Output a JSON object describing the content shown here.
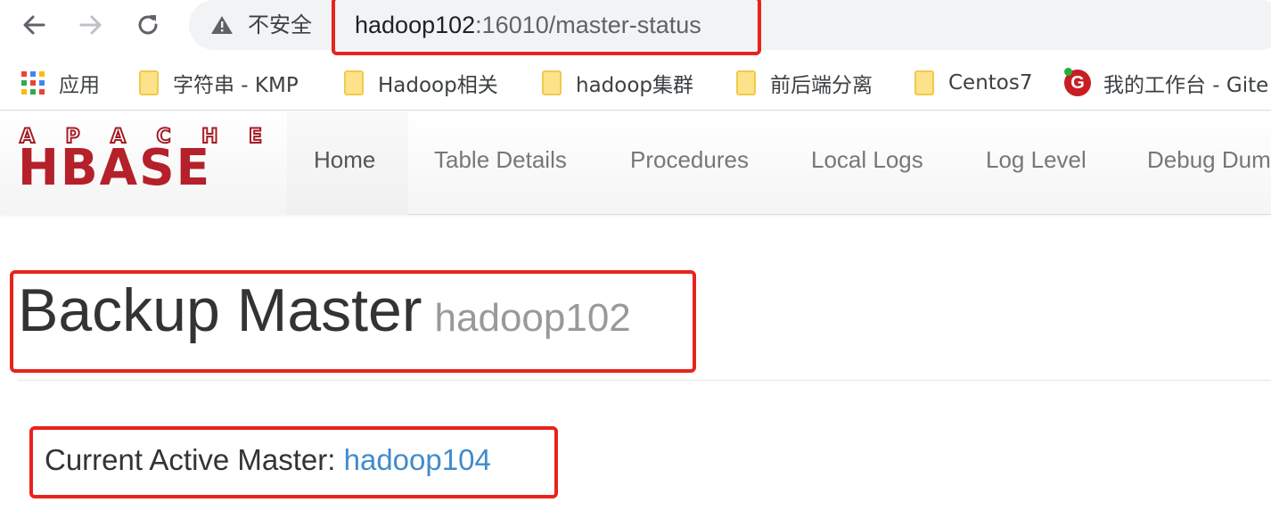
{
  "browser": {
    "security_label": "不安全",
    "url_host": "hadoop102",
    "url_path": ":16010/master-status",
    "icons": {
      "back": "back-arrow-icon",
      "forward": "forward-arrow-icon",
      "reload": "reload-icon",
      "warning": "warning-triangle-icon"
    }
  },
  "bookmarks": [
    {
      "label": "应用",
      "icon": "apps-grid-icon"
    },
    {
      "label": "字符串 - KMP",
      "icon": "folder-icon"
    },
    {
      "label": "Hadoop相关",
      "icon": "folder-icon"
    },
    {
      "label": "hadoop集群",
      "icon": "folder-icon"
    },
    {
      "label": "前后端分离",
      "icon": "folder-icon"
    },
    {
      "label": "Centos7",
      "icon": "folder-icon"
    },
    {
      "label": "我的工作台 - Gite",
      "icon": "gitee-icon"
    }
  ],
  "hbase": {
    "logo_top": "APACHE",
    "logo_main": "HBASE",
    "nav": [
      {
        "label": "Home",
        "active": true
      },
      {
        "label": "Table Details"
      },
      {
        "label": "Procedures"
      },
      {
        "label": "Local Logs"
      },
      {
        "label": "Log Level"
      },
      {
        "label": "Debug Dum"
      }
    ]
  },
  "page": {
    "title": "Backup Master",
    "title_host": "hadoop102",
    "active_master_label": "Current Active Master:",
    "active_master_host": "hadoop104"
  },
  "colors": {
    "highlight": "#e8231c",
    "link": "#428bca",
    "hbase_red": "#b5202a"
  }
}
